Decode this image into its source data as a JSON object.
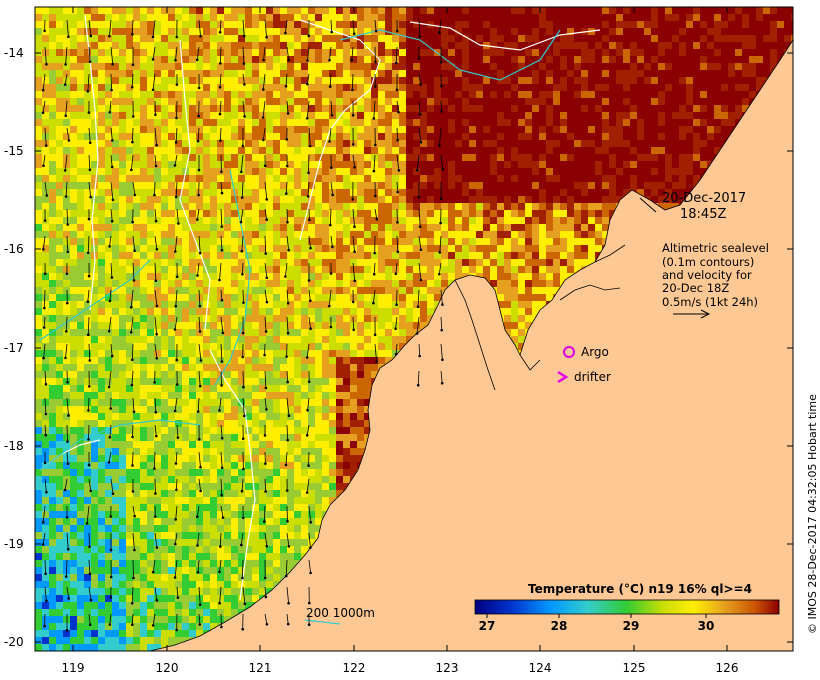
{
  "map": {
    "lat_ticks": [
      "-14",
      "-15",
      "-16",
      "-17",
      "-18",
      "-19",
      "-20"
    ],
    "lon_ticks": [
      "119",
      "120",
      "121",
      "122",
      "123",
      "124",
      "125",
      "126"
    ],
    "date_line1": "20-Dec-2017",
    "date_line2": "18:45Z",
    "info_lines": [
      "Altimetric sealevel",
      "(0.1m contours)",
      "and velocity for",
      "20-Dec 18Z",
      "0.5m/s (1kt 24h)"
    ],
    "argo_label": "Argo",
    "drifter_label": "drifter",
    "depth_label": "200  1000m",
    "colorbar_title": "Temperature (°C) n19 16% ql>=4",
    "colorbar_ticks": [
      "27",
      "28",
      "29",
      "30"
    ],
    "credit": "© IMOS 28-Dec-2017 04:32:05 Hobart time",
    "colors": {
      "land": "#fdc894",
      "argo": "#e600e6",
      "drifter": "#e600e6",
      "contour_white": "#ffffff",
      "contour_cyan": "#33cccc"
    }
  }
}
